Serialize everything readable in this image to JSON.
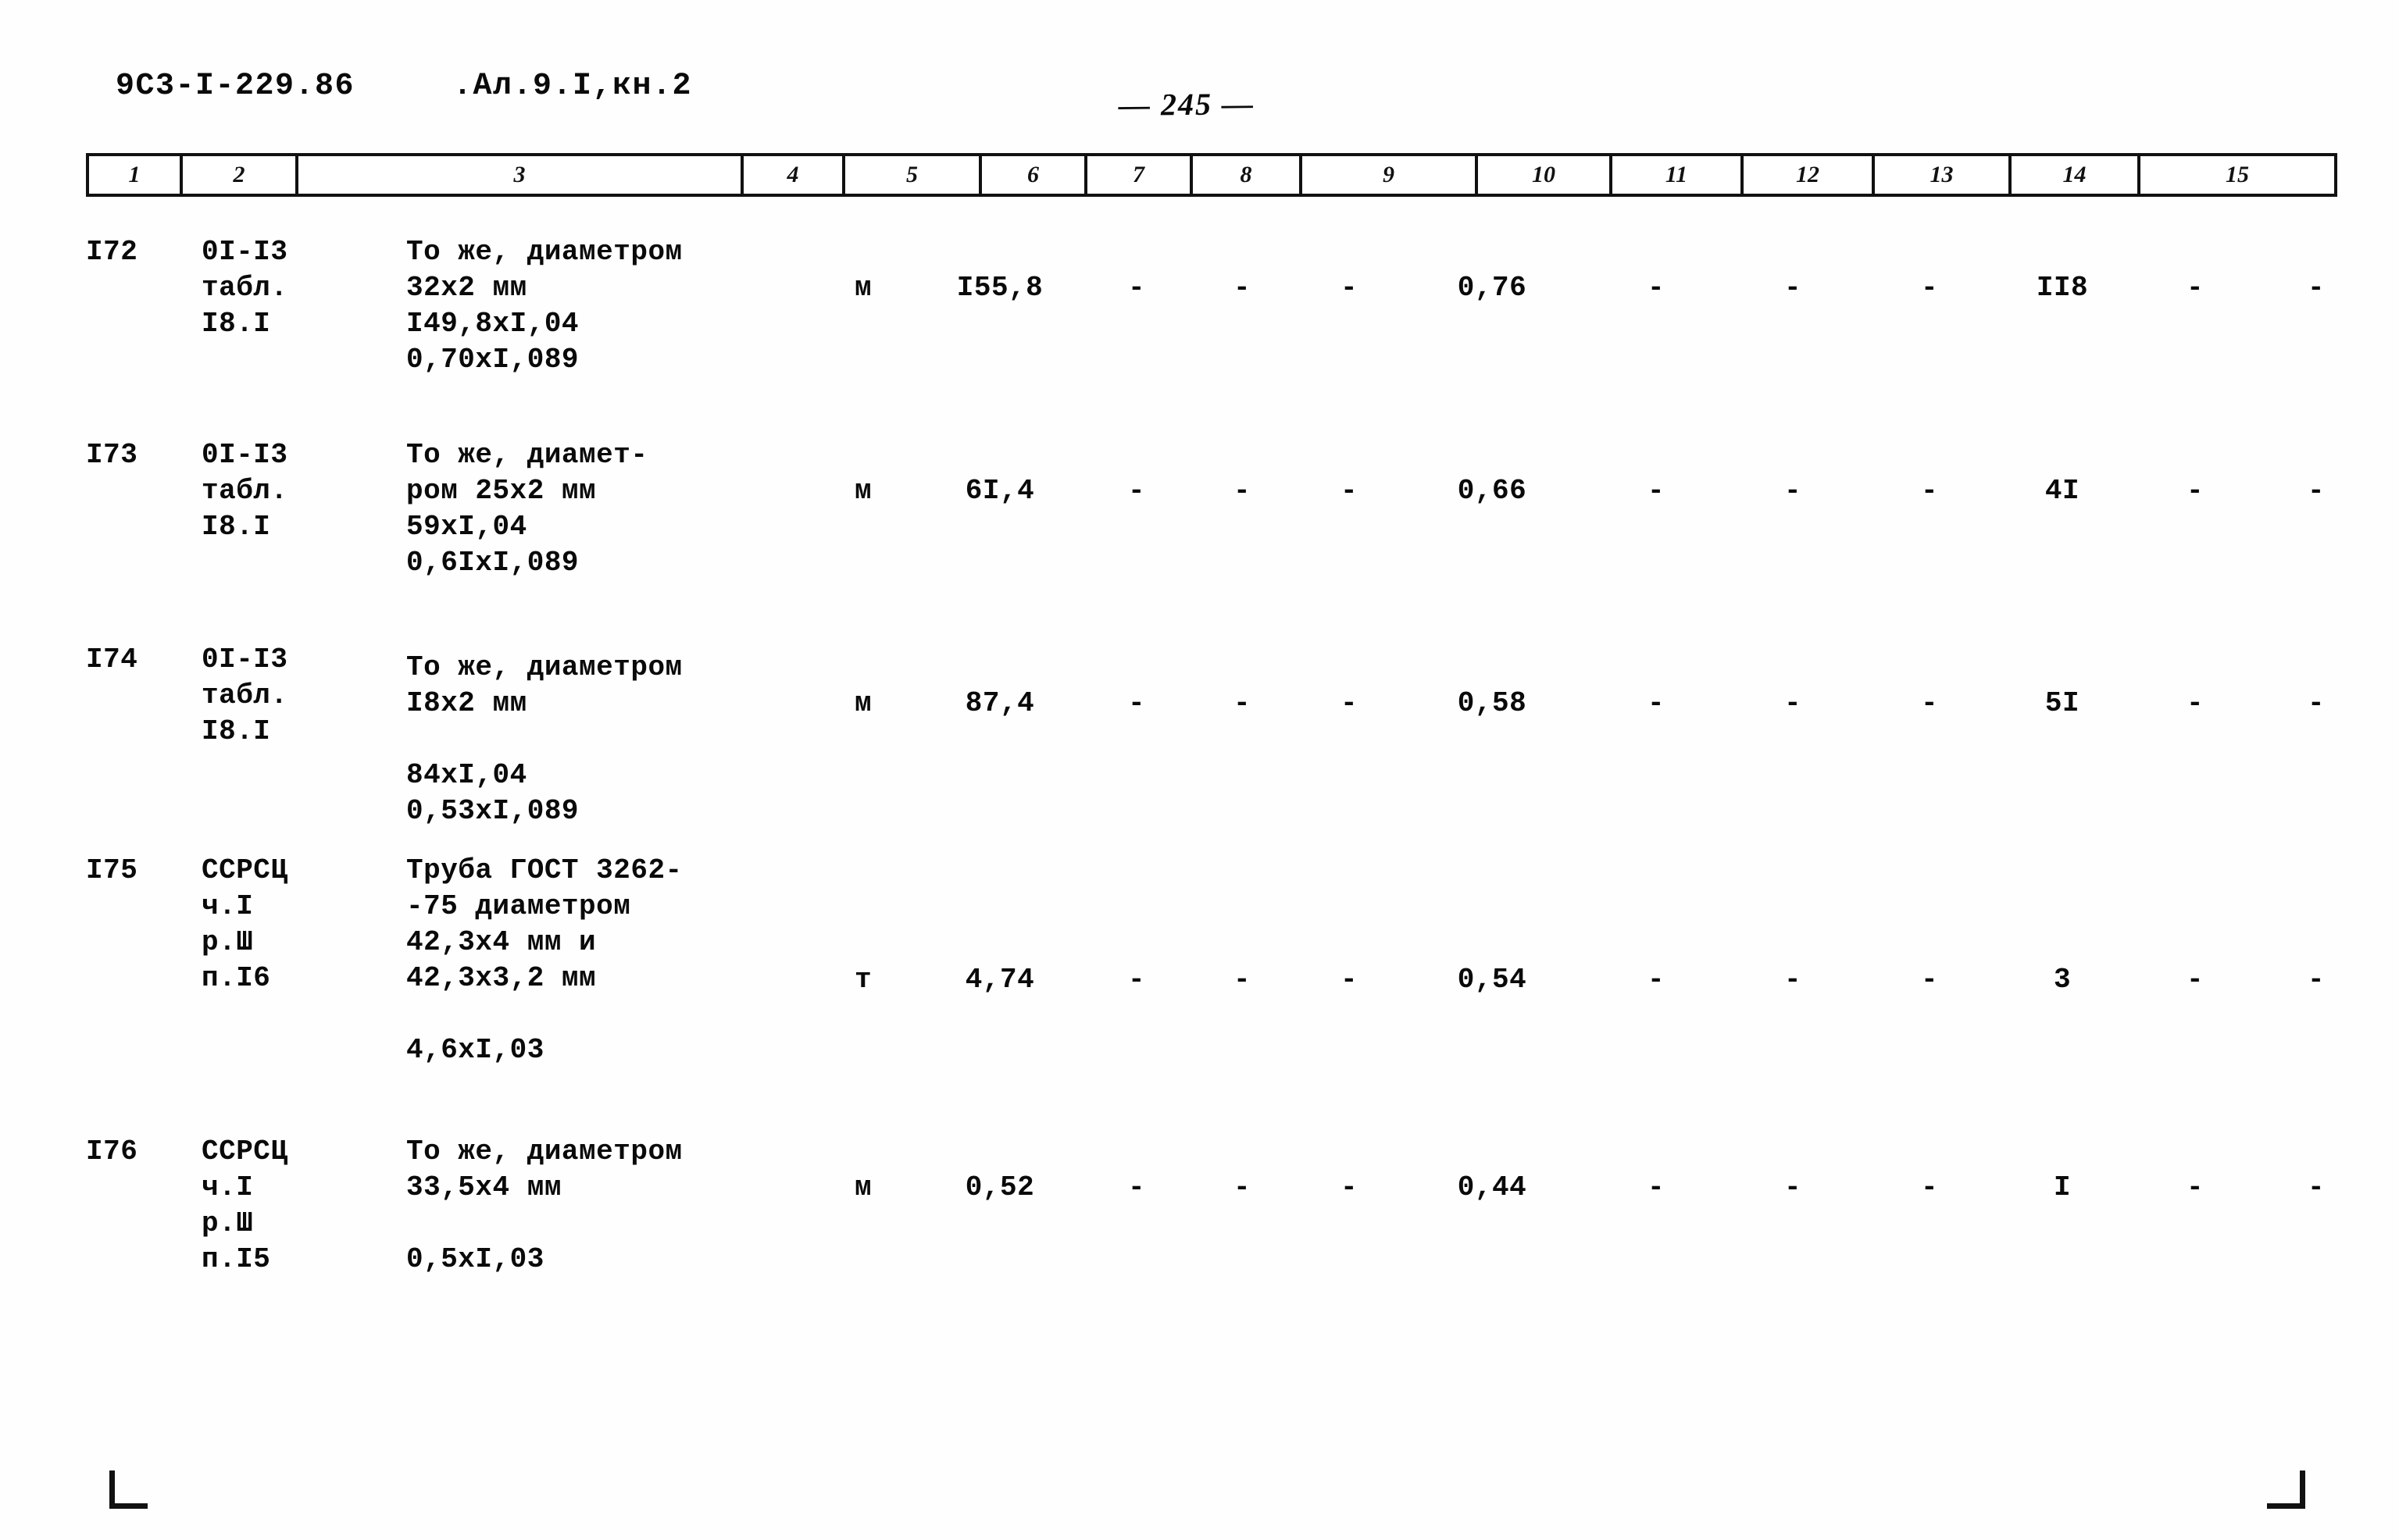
{
  "header": {
    "doc_code": "9С3-I-229.86",
    "album": ".Ал.9.I,кн.2",
    "page_number": "— 245 —"
  },
  "table": {
    "column_numbers": [
      "1",
      "2",
      "3",
      "4",
      "5",
      "6",
      "7",
      "8",
      "9",
      "10",
      "11",
      "12",
      "13",
      "14",
      "15"
    ],
    "rows": [
      {
        "num": "I72",
        "source": "0I-I3\nтабл.\nI8.I",
        "description": "То же, диаметром\n32x2 мм\nI49,8xI,04\n0,70xI,089",
        "unit": "м",
        "c5": "I55,8",
        "c6": "-",
        "c7": "-",
        "c8": "-",
        "c9": "0,76",
        "c10": "-",
        "c11": "-",
        "c12": "-",
        "c13": "II8",
        "c14": "-",
        "c15": "-"
      },
      {
        "num": "I73",
        "source": "0I-I3\nтабл.\nI8.I",
        "description": "То же, диамет-\nром 25x2 мм\n59xI,04\n0,6IxI,089",
        "unit": "м",
        "c5": "6I,4",
        "c6": "-",
        "c7": "-",
        "c8": "-",
        "c9": "0,66",
        "c10": "-",
        "c11": "-",
        "c12": "-",
        "c13": "4I",
        "c14": "-",
        "c15": "-"
      },
      {
        "num": "I74",
        "source": "0I-I3\nтабл.\nI8.I",
        "description": "То же, диаметром\nI8x2 мм\n\n84xI,04\n0,53xI,089",
        "unit": "м",
        "c5": "87,4",
        "c6": "-",
        "c7": "-",
        "c8": "-",
        "c9": "0,58",
        "c10": "-",
        "c11": "-",
        "c12": "-",
        "c13": "5I",
        "c14": "-",
        "c15": "-"
      },
      {
        "num": "I75",
        "source": "ССРСЦ\nч.I\nр.Ш\nп.I6",
        "description": "Труба ГОСТ 3262-\n-75 диаметром\n42,3x4 мм и\n42,3x3,2 мм\n\n4,6xI,03",
        "unit": "т",
        "c5": "4,74",
        "c6": "-",
        "c7": "-",
        "c8": "-",
        "c9": "0,54",
        "c10": "-",
        "c11": "-",
        "c12": "-",
        "c13": "3",
        "c14": "-",
        "c15": "-"
      },
      {
        "num": "I76",
        "source": "ССРСЦ\nч.I\nр.Ш\nп.I5",
        "description": "То же, диаметром\n33,5x4 мм\n\n0,5xI,03",
        "unit": "м",
        "c5": "0,52",
        "c6": "-",
        "c7": "-",
        "c8": "-",
        "c9": "0,44",
        "c10": "-",
        "c11": "-",
        "c12": "-",
        "c13": "I",
        "c14": "-",
        "c15": "-"
      }
    ]
  }
}
